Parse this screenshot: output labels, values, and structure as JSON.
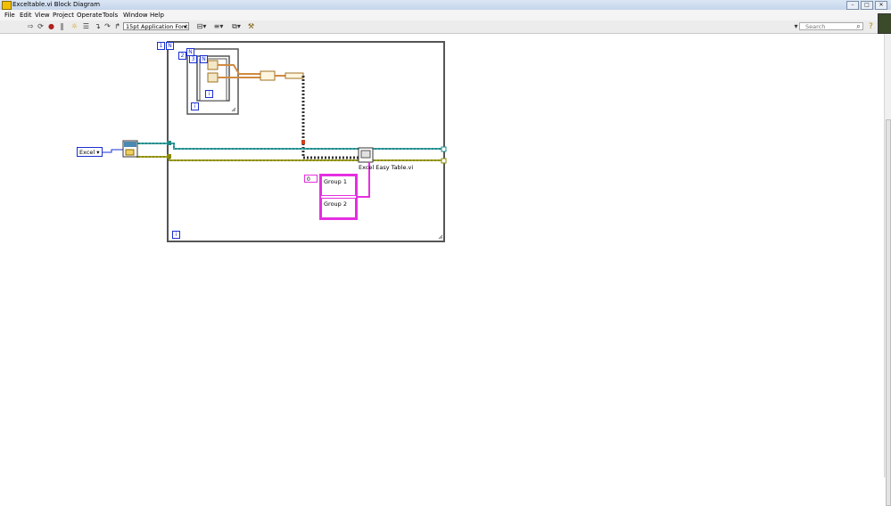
{
  "window": {
    "title": "Exceltable.vi Block Diagram",
    "minimize": "–",
    "maximize": "□",
    "close": "✕"
  },
  "menu": [
    "File",
    "Edit",
    "View",
    "Project",
    "Operate",
    "Tools",
    "Window",
    "Help"
  ],
  "toolbar": {
    "font": "15pt Application Font",
    "search_placeholder": "Search",
    "icons": [
      "run-arrow-icon",
      "run-continuously-icon",
      "abort-icon",
      "pause-icon",
      "highlight-execution-icon",
      "retain-wire-values-icon",
      "step-into-icon",
      "step-over-icon",
      "step-out-icon",
      "text-settings-icon",
      "align-objects-icon",
      "distribute-objects-icon",
      "reorder-icon",
      "cleanup-diagram-icon",
      "search-icon",
      "help-icon"
    ]
  },
  "diagram": {
    "ring_constant": "Excel",
    "outer_loop_count": "N",
    "inner_loop_count": "N",
    "innermost_loop_count": "N",
    "outer_counter_label": "1",
    "inner_counter_label": "2",
    "innermost_counter_label": "3",
    "iteration": "i",
    "subvi_label": "Excel Easy Table.vi",
    "index_constant": "0",
    "cluster_elements": [
      "Group 1",
      "Group 2"
    ]
  },
  "colors": {
    "border_blue": "#1a2fd0",
    "cluster_pink": "#e52fe0",
    "refnum_teal": "#1e8a8a",
    "error_olive": "#8a8a00",
    "string_orange": "#d08a40"
  }
}
